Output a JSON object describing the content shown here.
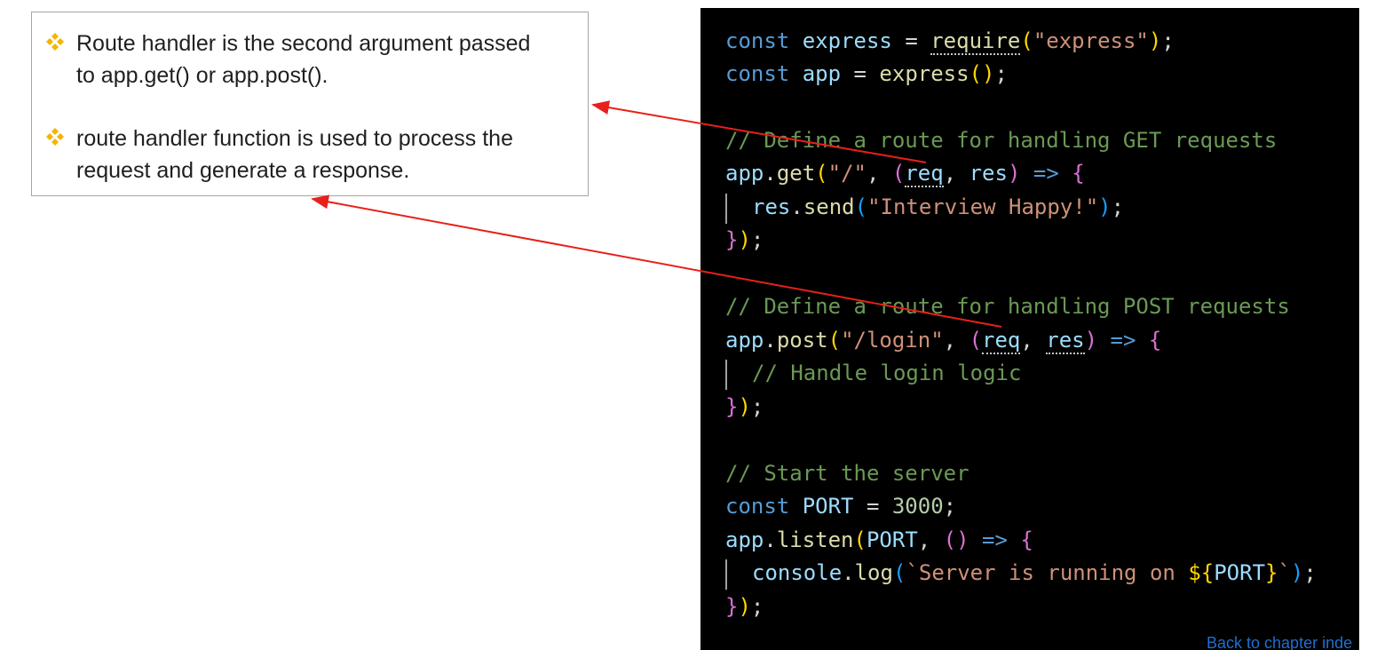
{
  "callout": {
    "bullets": [
      {
        "line1": "Route handler is the second argument passed",
        "line2": "to app.get() or app.post()."
      },
      {
        "line1": "route handler function is used to process the",
        "line2": "request and generate a response."
      }
    ],
    "bullet_icon": "four-diamond-bullet-icon",
    "bullet_color": "#f4b400"
  },
  "code": {
    "l1": {
      "a": "const",
      "b": "express",
      "c": "=",
      "d": "require",
      "e": "(",
      "f": "\"express\"",
      "g": ")",
      "h": ";"
    },
    "l2": {
      "a": "const",
      "b": "app",
      "c": "=",
      "d": "express",
      "e": "()",
      "f": ";"
    },
    "l3": {
      "text": "// Define a route for handling GET requests"
    },
    "l4": {
      "a": "app",
      "b": ".",
      "c": "get",
      "d": "(",
      "e": "\"/\"",
      "f": ", ",
      "g": "(",
      "h": "req",
      "i": ", ",
      "j": "res",
      "k": ")",
      "l": " => ",
      "m": "{"
    },
    "l5": {
      "a": "res",
      "b": ".",
      "c": "send",
      "d": "(",
      "e": "\"Interview Happy!\"",
      "f": ")",
      "g": ";"
    },
    "l6": {
      "a": "}",
      "b": ")",
      "c": ";"
    },
    "l7": {
      "text": "// Define a route for handling POST requests"
    },
    "l8": {
      "a": "app",
      "b": ".",
      "c": "post",
      "d": "(",
      "e": "\"/login\"",
      "f": ", ",
      "g": "(",
      "h": "req",
      "i": ", ",
      "j": "res",
      "k": ")",
      "l": " => ",
      "m": "{"
    },
    "l9": {
      "text": "// Handle login logic"
    },
    "l10": {
      "a": "}",
      "b": ")",
      "c": ";"
    },
    "l11": {
      "text": "// Start the server"
    },
    "l12": {
      "a": "const",
      "b": "PORT",
      "c": "=",
      "d": "3000",
      "e": ";"
    },
    "l13": {
      "a": "app",
      "b": ".",
      "c": "listen",
      "d": "(",
      "e": "PORT",
      "f": ", ",
      "g": "()",
      "h": " => ",
      "i": "{"
    },
    "l14": {
      "a": "console",
      "b": ".",
      "c": "log",
      "d": "(",
      "e": "`Server is running on ",
      "f": "${",
      "g": "PORT",
      "h": "}",
      "i": "`",
      "j": ")",
      "k": ";"
    },
    "l15": {
      "a": "}",
      "b": ")",
      "c": ";"
    }
  },
  "annotation_arrow_color": "#e8201a",
  "footer": {
    "back_link": "Back to chapter inde"
  }
}
